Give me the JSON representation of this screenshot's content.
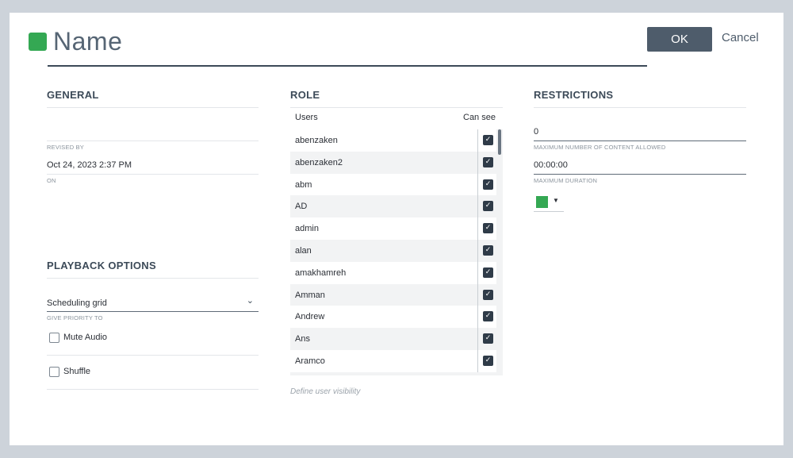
{
  "header": {
    "title": "Name",
    "ok_label": "OK",
    "cancel_label": "Cancel",
    "accent_color": "#34a853"
  },
  "general": {
    "title": "GENERAL",
    "revised_by_label": "REVISED BY",
    "revised_on_value": "Oct 24, 2023 2:37 PM",
    "on_label": "ON"
  },
  "playback": {
    "title": "PLAYBACK OPTIONS",
    "priority_value": "Scheduling grid",
    "priority_label": "GIVE PRIORITY TO",
    "options": [
      {
        "label": "Mute Audio",
        "checked": false
      },
      {
        "label": "Shuffle",
        "checked": false
      }
    ]
  },
  "role": {
    "title": "ROLE",
    "col_users": "Users",
    "col_can_see": "Can see",
    "users": [
      {
        "name": "abenzaken",
        "can_see": true
      },
      {
        "name": "abenzaken2",
        "can_see": true
      },
      {
        "name": "abm",
        "can_see": true
      },
      {
        "name": "AD",
        "can_see": true
      },
      {
        "name": "admin",
        "can_see": true
      },
      {
        "name": "alan",
        "can_see": true
      },
      {
        "name": "amakhamreh",
        "can_see": true
      },
      {
        "name": "Amman",
        "can_see": true
      },
      {
        "name": "Andrew",
        "can_see": true
      },
      {
        "name": "Ans",
        "can_see": true
      },
      {
        "name": "Aramco",
        "can_see": true
      }
    ],
    "hint": "Define user visibility"
  },
  "restrictions": {
    "title": "RESTRICTIONS",
    "max_content_value": "0",
    "max_content_label": "MAXIMUM NUMBER OF CONTENT ALLOWED",
    "max_duration_value": "00:00:00",
    "max_duration_label": "MAXIMUM DURATION",
    "color_value": "#34a853"
  }
}
